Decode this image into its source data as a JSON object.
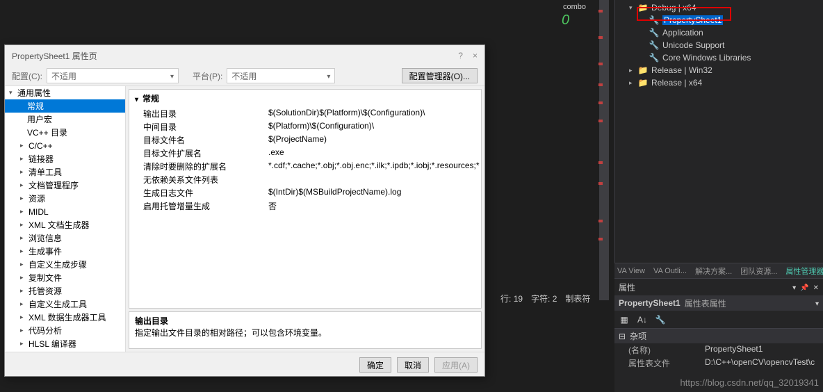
{
  "combo": {
    "label": "combo",
    "value": "0"
  },
  "status": {
    "line_label": "行:",
    "line": "19",
    "col_label": "字符:",
    "col": "2",
    "mode": "制表符"
  },
  "tree": {
    "debug_x64": "Debug | x64",
    "items": [
      "PropertySheet1",
      "Application",
      "Unicode Support",
      "Core Windows Libraries"
    ],
    "release_win32": "Release | Win32",
    "release_x64": "Release | x64"
  },
  "tabs": [
    "VA View",
    "VA Outli...",
    "解决方案...",
    "团队资源...",
    "属性管理器"
  ],
  "props_panel": {
    "title": "属性",
    "sub_name": "PropertySheet1",
    "sub_type": "属性表属性",
    "category": "杂项",
    "rows": [
      {
        "k": "(名称)",
        "v": "PropertySheet1"
      },
      {
        "k": "属性表文件",
        "v": "D:\\C++\\openCV\\opencvTest\\c"
      }
    ]
  },
  "dialog": {
    "title": "PropertySheet1 属性页",
    "help": "?",
    "close": "×",
    "config_label": "配置(C):",
    "config_value": "不适用",
    "platform_label": "平台(P):",
    "platform_value": "不适用",
    "config_mgr": "配置管理器(O)...",
    "tree_root": "通用属性",
    "tree_items": [
      "常规",
      "用户宏",
      "VC++ 目录",
      "C/C++",
      "链接器",
      "清单工具",
      "文档管理程序",
      "资源",
      "MIDL",
      "XML 文档生成器",
      "浏览信息",
      "生成事件",
      "自定义生成步骤",
      "复制文件",
      "托管资源",
      "自定义生成工具",
      "XML 数据生成器工具",
      "代码分析",
      "HLSL 编译器"
    ],
    "grid_head": "常规",
    "grid_rows": [
      {
        "k": "输出目录",
        "v": "$(SolutionDir)$(Platform)\\$(Configuration)\\"
      },
      {
        "k": "中间目录",
        "v": "$(Platform)\\$(Configuration)\\"
      },
      {
        "k": "目标文件名",
        "v": "$(ProjectName)"
      },
      {
        "k": "目标文件扩展名",
        "v": ".exe"
      },
      {
        "k": "清除时要删除的扩展名",
        "v": "*.cdf;*.cache;*.obj;*.obj.enc;*.ilk;*.ipdb;*.iobj;*.resources;*"
      },
      {
        "k": "无依赖关系文件列表",
        "v": ""
      },
      {
        "k": "生成日志文件",
        "v": "$(IntDir)$(MSBuildProjectName).log"
      },
      {
        "k": "启用托管增量生成",
        "v": "否"
      }
    ],
    "desc_title": "输出目录",
    "desc_body": "指定输出文件目录的相对路径；可以包含环境变量。",
    "ok": "确定",
    "cancel": "取消",
    "apply": "应用(A)"
  },
  "watermark": "https://blog.csdn.net/qq_32019341"
}
